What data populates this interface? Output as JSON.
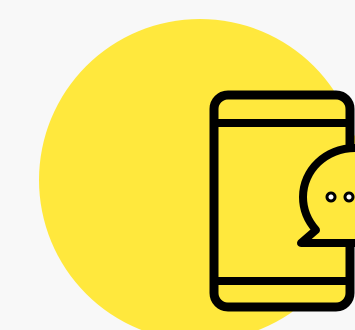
{
  "illustration": {
    "icon_name": "phone-chat-icon",
    "colors": {
      "background": "#f8f8f8",
      "circle": "#ffe83d",
      "outline": "#000000",
      "bubble_fill": "#ffe83d",
      "dot_fill": "#ffffff"
    }
  }
}
